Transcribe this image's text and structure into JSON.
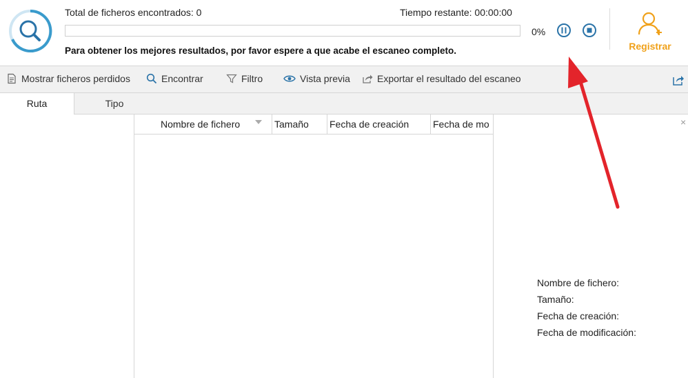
{
  "header": {
    "found_text": "Total de ficheros encontrados:  0",
    "remaining_text": "Tiempo restante:  00:00:00",
    "progress_percent": 0,
    "percent_label": "0%",
    "hint_text": "Para obtener los mejores resultados, por favor espere a que acabe el escaneo completo.",
    "register_label": "Registrar"
  },
  "toolbar": {
    "show_lost": "Mostrar ficheros perdidos",
    "find": "Encontrar",
    "filter": "Filtro",
    "preview": "Vista previa",
    "export": "Exportar el resultado del escaneo"
  },
  "tabs": {
    "path": "Ruta",
    "type": "Tipo"
  },
  "columns": {
    "name": "Nombre de fichero",
    "size": "Tamaño",
    "created": "Fecha de creación",
    "modified": "Fecha de mo"
  },
  "preview_panel": {
    "name_label": "Nombre de fichero:",
    "size_label": "Tamaño:",
    "created_label": "Fecha de creación:",
    "modified_label": "Fecha de modificación:"
  },
  "colors": {
    "accent_blue": "#2a73a8",
    "register_orange": "#f0a11a"
  }
}
